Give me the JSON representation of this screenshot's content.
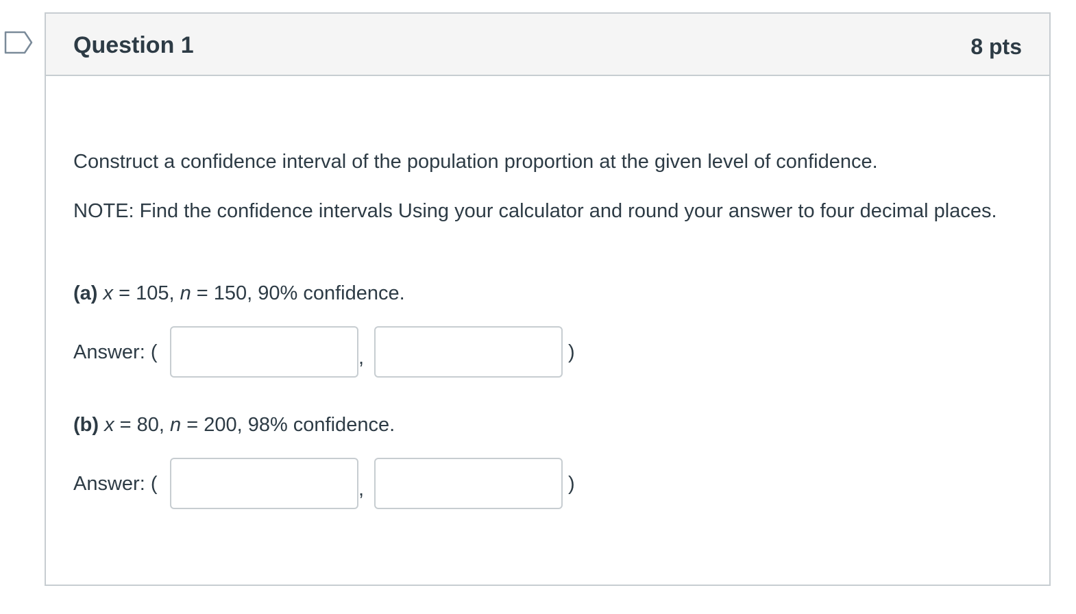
{
  "question": {
    "title": "Question 1",
    "points": "8 pts",
    "flag_icon": "flag-outline-icon",
    "instruction": "Construct a confidence interval of the population proportion at the given level of confidence.",
    "note": "NOTE: Find the confidence intervals Using your calculator and round your answer to four decimal places.",
    "parts": [
      {
        "label": "(a)",
        "x_var": "x",
        "x_eq": " = 105, ",
        "n_var": "n",
        "n_eq": " = 150, 90% confidence.",
        "answer_label": "Answer: (",
        "separator": ",",
        "closing": ")",
        "lower_value": "",
        "upper_value": ""
      },
      {
        "label": "(b)",
        "x_var": "x",
        "x_eq": " = 80, ",
        "n_var": "n",
        "n_eq": " = 200, 98% confidence.",
        "answer_label": "Answer: (",
        "separator": ",",
        "closing": ")",
        "lower_value": "",
        "upper_value": ""
      }
    ]
  }
}
